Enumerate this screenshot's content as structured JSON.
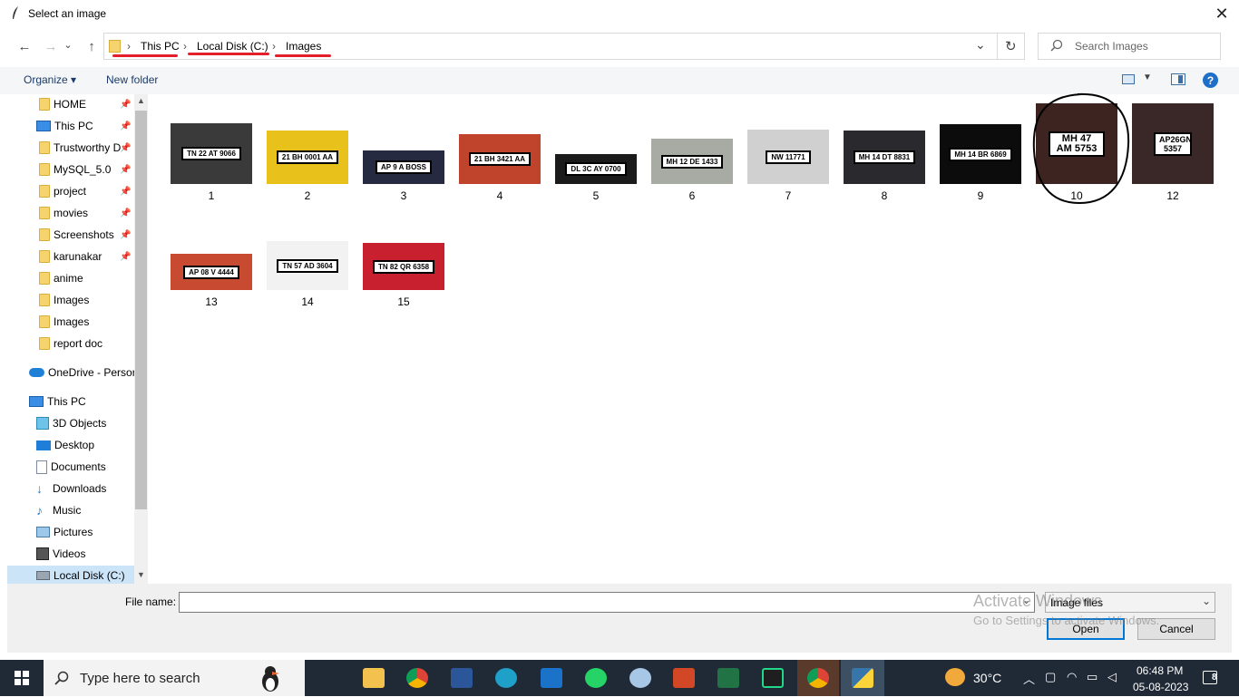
{
  "window": {
    "title": "Select an image",
    "close": "✕"
  },
  "nav": {
    "back": "←",
    "forward": "→",
    "recent": "⌄",
    "up": "↑",
    "breadcrumbs": [
      "This PC",
      "Local Disk (C:)",
      "Images"
    ],
    "separator": "›",
    "dropdown": "⌄",
    "refresh": "↻",
    "search_placeholder": "Search Images"
  },
  "toolbar": {
    "organize": "Organize ▾",
    "new_folder": "New folder",
    "help": "?"
  },
  "sidebar": {
    "quick_access": [
      {
        "label": "HOME",
        "pinned": true
      },
      {
        "label": "This PC",
        "pinned": true
      },
      {
        "label": "Trustworthy D",
        "pinned": true
      },
      {
        "label": "MySQL_5.0",
        "pinned": true
      },
      {
        "label": "project",
        "pinned": true
      },
      {
        "label": "movies",
        "pinned": true
      },
      {
        "label": "Screenshots",
        "pinned": true
      },
      {
        "label": "karunakar",
        "pinned": true
      },
      {
        "label": "anime",
        "pinned": false
      },
      {
        "label": "Images",
        "pinned": false
      },
      {
        "label": "Images",
        "pinned": false
      },
      {
        "label": "report doc",
        "pinned": false
      }
    ],
    "onedrive": "OneDrive - Persor",
    "this_pc": "This PC",
    "pc_items": [
      "3D Objects",
      "Desktop",
      "Documents",
      "Downloads",
      "Music",
      "Pictures",
      "Videos",
      "Local Disk (C:)"
    ]
  },
  "files": [
    {
      "name": "1",
      "plate": "TN 22 AT 9066",
      "bg": "#3a3a3a"
    },
    {
      "name": "2",
      "plate": "21 BH 0001 AA",
      "bg": "#e8c21a"
    },
    {
      "name": "3",
      "plate": "AP 9 A BOSS",
      "bg": "#262a40"
    },
    {
      "name": "4",
      "plate": "21 BH 3421 AA",
      "bg": "#c0432c"
    },
    {
      "name": "5",
      "plate": "DL 3C AY 0700",
      "bg": "#1b1b1b"
    },
    {
      "name": "6",
      "plate": "MH 12 DE 1433",
      "bg": "#a8aaa4"
    },
    {
      "name": "7",
      "plate": "NW 11771",
      "bg": "#d0d0d0"
    },
    {
      "name": "8",
      "plate": "MH 14 DT 8831",
      "bg": "#2a2a2e"
    },
    {
      "name": "9",
      "plate": "MH 14 BR 6869",
      "bg": "#0c0c0c"
    },
    {
      "name": "10",
      "plate": "MH 47 AM 5753",
      "bg": "#3d2420"
    },
    {
      "name": "12",
      "plate": "AP26GN 5357",
      "bg": "#3a2828"
    },
    {
      "name": "13",
      "plate": "AP 08 V 4444",
      "bg": "#c84a30"
    },
    {
      "name": "14",
      "plate": "TN 57 AD 3604",
      "bg": "#f2f2f2"
    },
    {
      "name": "15",
      "plate": "TN 82 QR 6358",
      "bg": "#c8202e"
    }
  ],
  "bottom": {
    "file_name_label": "File name:",
    "file_name_value": "",
    "filter": "Image files",
    "open": "Open",
    "cancel": "Cancel"
  },
  "watermark": {
    "line1": "Activate Windows",
    "line2": "Go to Settings to activate Windows."
  },
  "taskbar": {
    "search_placeholder": "Type here to search",
    "temperature": "30°C",
    "time": "06:48 PM",
    "date": "05-08-2023",
    "notifications": "8"
  }
}
